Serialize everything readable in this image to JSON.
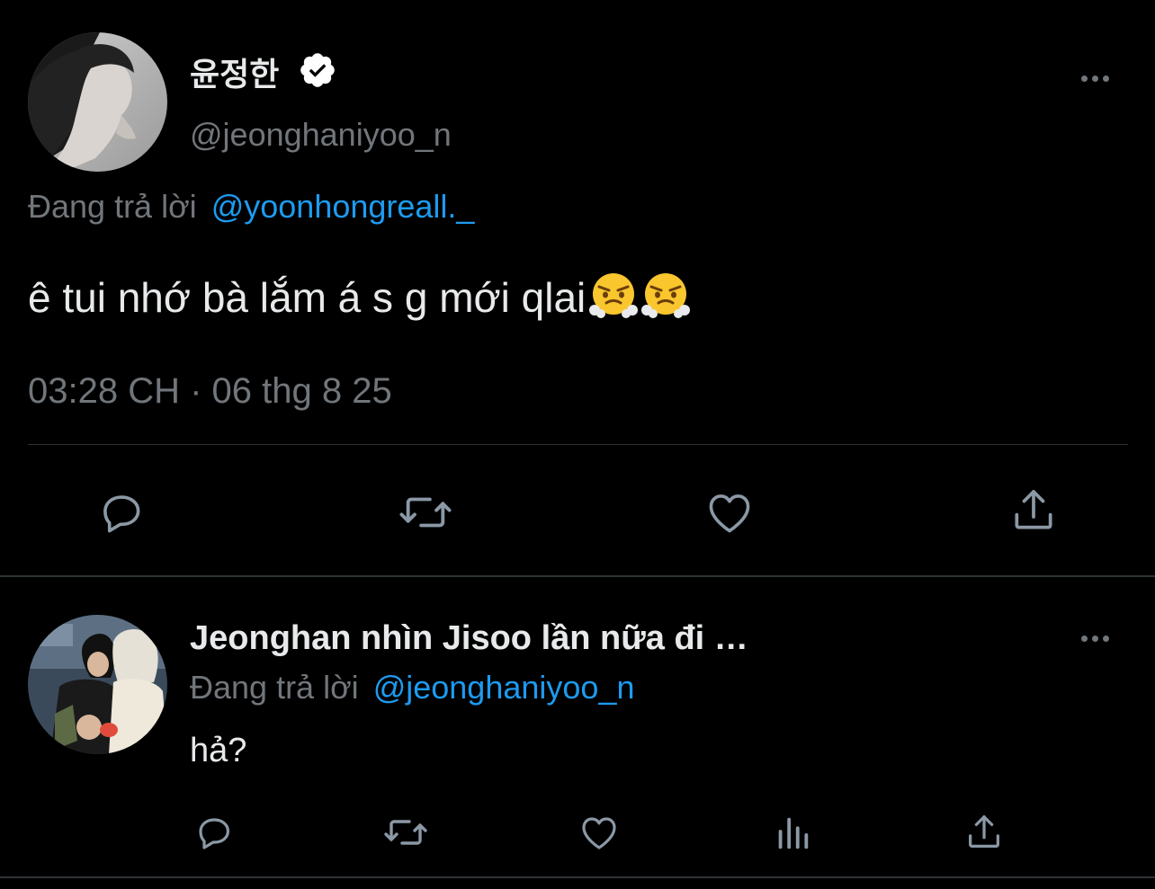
{
  "main_tweet": {
    "display_name": "윤정한",
    "handle": "@jeonghaniyoo_n",
    "reply_prefix": "Đang trả lời",
    "reply_to": "@yoonhongreall._",
    "text": "ê tui nhớ bà lắm á s g mới qlai",
    "emojis": [
      "face-with-steam-from-nose",
      "face-with-steam-from-nose"
    ],
    "timestamp": "03:28 CH · 06 thg 8 25",
    "verified": true,
    "actions": [
      "reply-icon",
      "retweet-icon",
      "like-icon",
      "share-icon"
    ]
  },
  "reply_tweet": {
    "display_name": "Jeonghan nhìn Jisoo lần nữa đi …",
    "reply_prefix": "Đang trả lời",
    "reply_to": "@jeonghaniyoo_n",
    "text": "hả?",
    "actions": [
      "reply-icon",
      "retweet-icon",
      "like-icon",
      "views-icon",
      "share-icon"
    ]
  },
  "colors": {
    "background": "#000000",
    "text": "#e7e9ea",
    "secondary": "#71767b",
    "accent": "#1d9bf0",
    "divider": "#2f3336"
  }
}
